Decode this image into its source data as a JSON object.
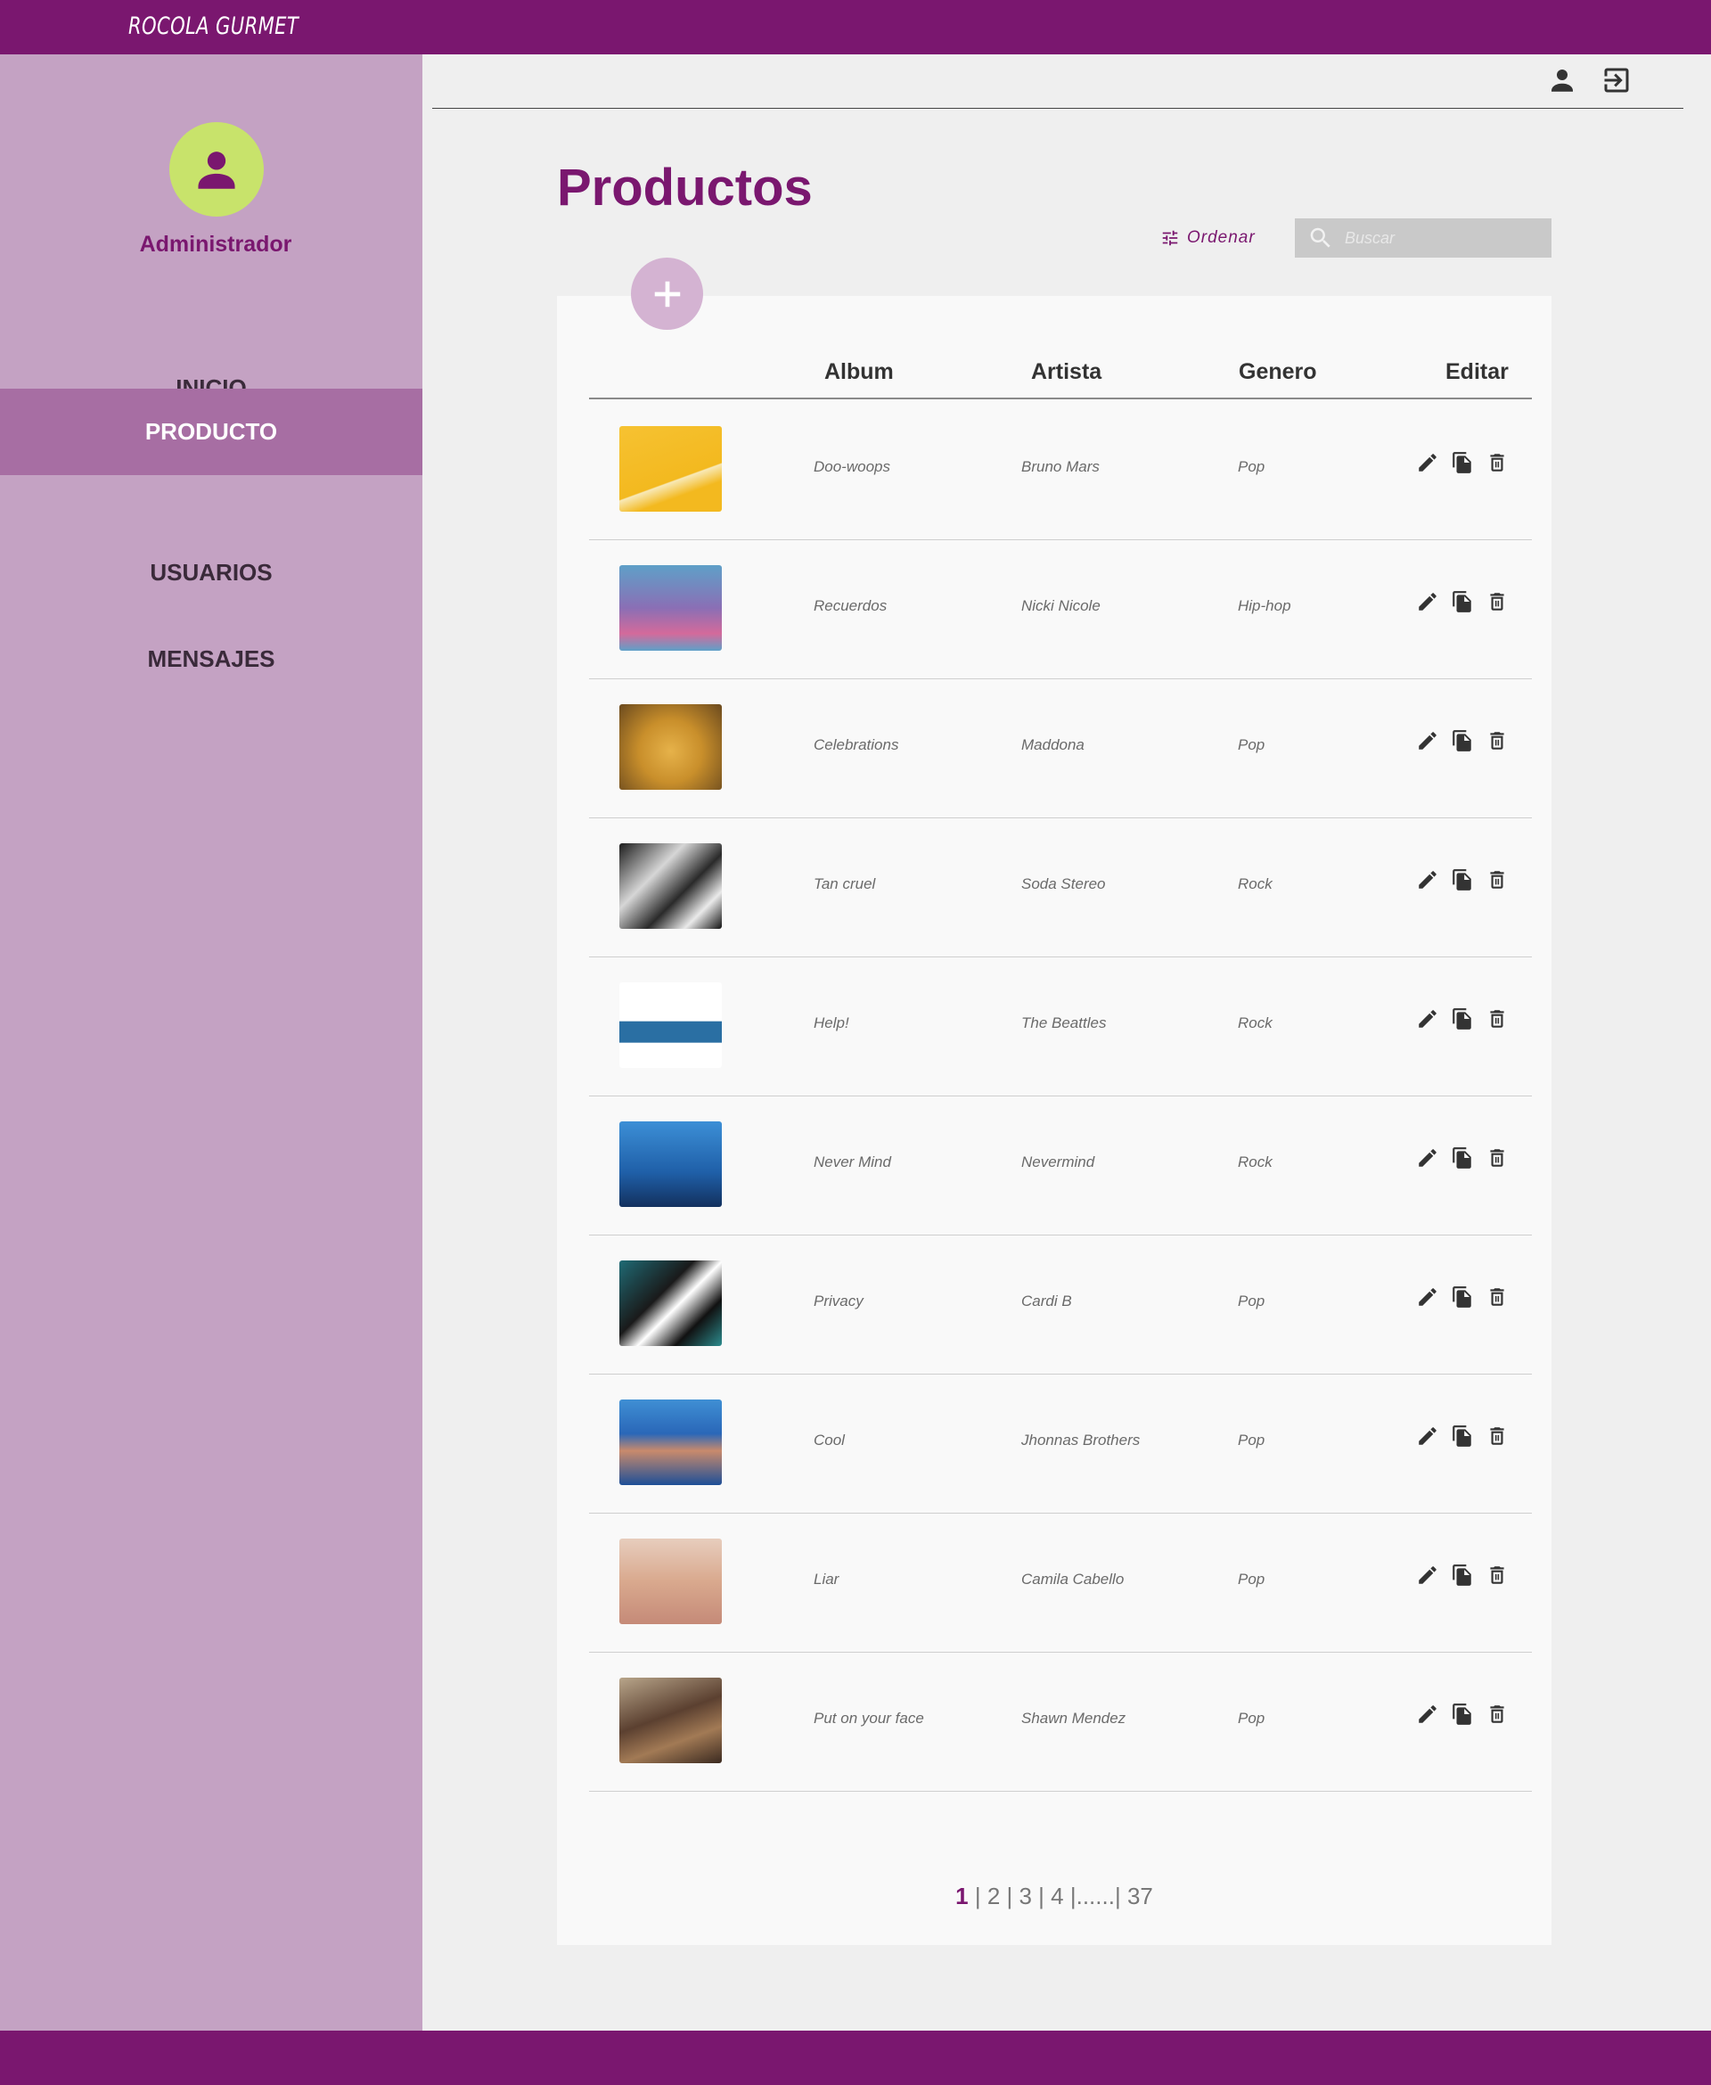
{
  "app": {
    "brand": "ROCOLA GURMET"
  },
  "sidebar": {
    "role": "Administrador",
    "items": [
      {
        "label": "INICIO",
        "active": false
      },
      {
        "label": "PRODUCTO",
        "active": true
      },
      {
        "label": "USUARIOS",
        "active": false
      },
      {
        "label": "MENSAJES",
        "active": false
      }
    ]
  },
  "header": {
    "icons": [
      "person-icon",
      "logout-icon"
    ]
  },
  "main": {
    "title": "Productos",
    "sort_label": "Ordenar",
    "search": {
      "placeholder": "Buscar",
      "value": ""
    },
    "columns": [
      "Album",
      "Artista",
      "Genero",
      "Editar"
    ],
    "rows": [
      {
        "album": "Doo-woops",
        "artist": "Bruno Mars",
        "genre": "Pop"
      },
      {
        "album": "Recuerdos",
        "artist": "Nicki Nicole",
        "genre": "Hip-hop"
      },
      {
        "album": "Celebrations",
        "artist": "Maddona",
        "genre": "Pop"
      },
      {
        "album": "Tan cruel",
        "artist": "Soda Stereo",
        "genre": "Rock"
      },
      {
        "album": "Help!",
        "artist": "The Beattles",
        "genre": "Rock"
      },
      {
        "album": "Never Mind",
        "artist": "Nevermind",
        "genre": "Rock"
      },
      {
        "album": "Privacy",
        "artist": "Cardi B",
        "genre": "Pop"
      },
      {
        "album": "Cool",
        "artist": "Jhonnas Brothers",
        "genre": "Pop"
      },
      {
        "album": "Liar",
        "artist": "Camila Cabello",
        "genre": "Pop"
      },
      {
        "album": "Put on your face",
        "artist": "Shawn Mendez",
        "genre": "Pop"
      }
    ],
    "pagination": {
      "current": "1",
      "pages": [
        "2",
        "3",
        "4"
      ],
      "ellipsis": "......",
      "last": "37"
    }
  },
  "colors": {
    "brand": "#7a176f",
    "sidebar": "#c4a2c3",
    "sidebar_active": "#a76ea3",
    "avatar": "#c8e36b"
  }
}
